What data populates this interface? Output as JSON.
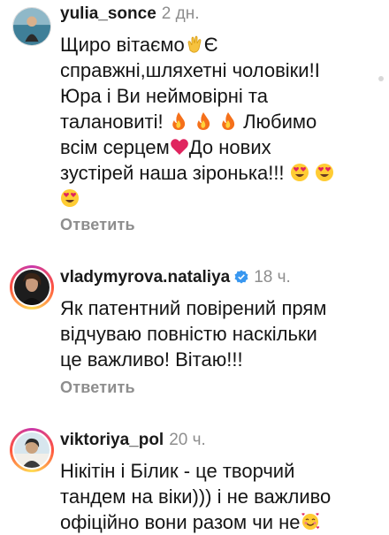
{
  "comments": [
    {
      "username": "yulia_sonce",
      "time": "2 дн.",
      "text_lines": [
        [
          "Щиро вітаємо",
          "clap",
          "Є"
        ],
        [
          "справжні,шляхетні чоловіки!І"
        ],
        [
          "Юра і Ви неймовірні та"
        ],
        [
          "талановиті!",
          "fire",
          "fire",
          "fire",
          "Любимо"
        ],
        [
          "всім серцем",
          "heart",
          "До нових"
        ],
        [
          "зустірей наша зіронька!!!",
          "heart-eyes",
          "heart-eyes"
        ],
        [
          "heart-eyes"
        ]
      ],
      "reply_label": "Ответить"
    },
    {
      "username": "vladymyrova.nataliya",
      "verified": true,
      "time": "18 ч.",
      "text_lines": [
        [
          "Як патентний повірений прям"
        ],
        [
          "відчуваю повністю наскільки"
        ],
        [
          "це важливо! Вітаю!!!"
        ]
      ],
      "reply_label": "Ответить"
    },
    {
      "username": "viktoriya_pol",
      "time": "20 ч.",
      "text_lines": [
        [
          "Нікітін і Білик - це творчий"
        ],
        [
          "тандем на віки))) і не важливо"
        ],
        [
          "офіційно вони разом чи не",
          "smiling-hearts"
        ]
      ]
    }
  ],
  "colors": {
    "text": "#151515",
    "muted": "#8e8e8e",
    "verified": "#3897f0",
    "heart": "#e0245e"
  }
}
